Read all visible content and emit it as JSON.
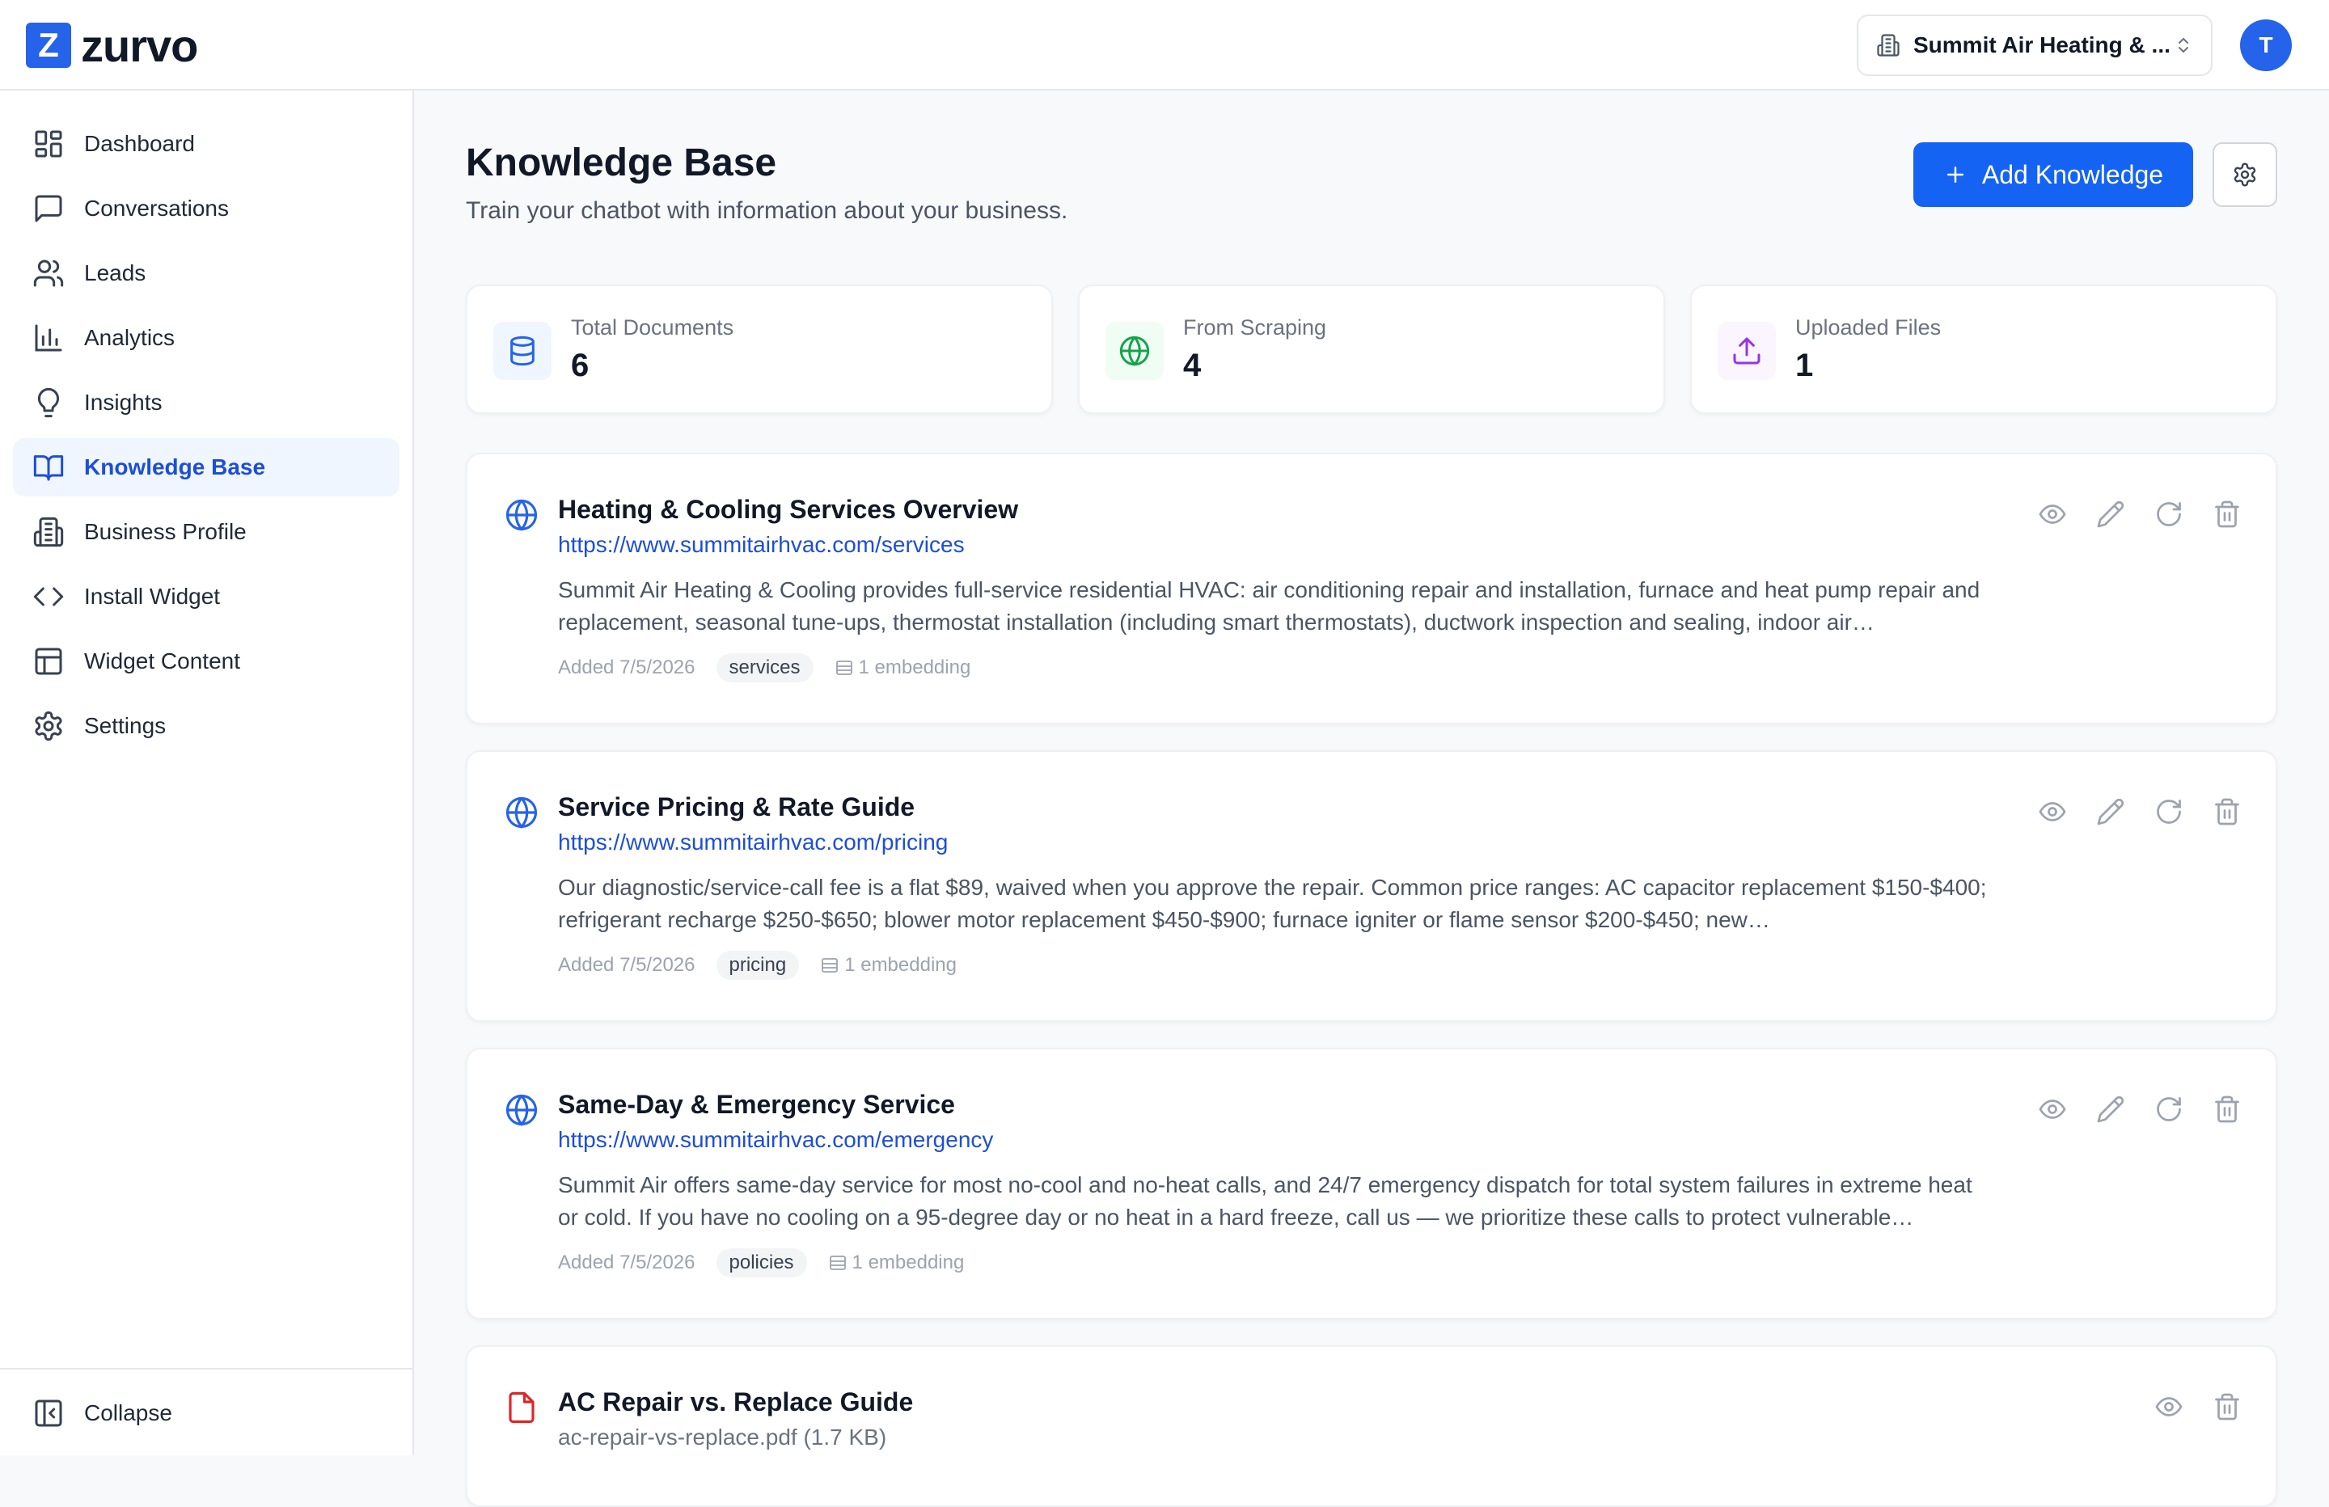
{
  "header": {
    "logo_letter": "Z",
    "logo_text": "zurvo",
    "business_name": "Summit Air Heating & ...",
    "avatar_initial": "T"
  },
  "sidebar": {
    "items": [
      {
        "label": "Dashboard",
        "icon": "dashboard-icon"
      },
      {
        "label": "Conversations",
        "icon": "chat-icon"
      },
      {
        "label": "Leads",
        "icon": "users-icon"
      },
      {
        "label": "Analytics",
        "icon": "bar-chart-icon"
      },
      {
        "label": "Insights",
        "icon": "lightbulb-icon"
      },
      {
        "label": "Knowledge Base",
        "icon": "book-icon",
        "active": true
      },
      {
        "label": "Business Profile",
        "icon": "building-icon"
      },
      {
        "label": "Install Widget",
        "icon": "code-icon"
      },
      {
        "label": "Widget Content",
        "icon": "layout-icon"
      },
      {
        "label": "Settings",
        "icon": "gear-icon"
      }
    ],
    "collapse_label": "Collapse"
  },
  "page": {
    "title": "Knowledge Base",
    "subtitle": "Train your chatbot with information about your business.",
    "add_button": "Add Knowledge"
  },
  "stats": [
    {
      "label": "Total Documents",
      "value": "6",
      "icon": "database-icon",
      "color": "#2563eb"
    },
    {
      "label": "From Scraping",
      "value": "4",
      "icon": "globe-icon",
      "color": "#16a34a"
    },
    {
      "label": "Uploaded Files",
      "value": "1",
      "icon": "upload-icon",
      "color": "#9333ea"
    }
  ],
  "documents": [
    {
      "title": "Heating & Cooling Services Overview",
      "url": "https://www.summitairhvac.com/services",
      "text": "Summit Air Heating & Cooling provides full-service residential HVAC: air conditioning repair and installation, furnace and heat pump repair and replacement, seasonal tune-ups, thermostat installation (including smart thermostats), ductwork inspection and sealing, indoor air…",
      "added": "Added 7/5/2026",
      "tag": "services",
      "embeddings": "1 embedding"
    },
    {
      "title": "Service Pricing & Rate Guide",
      "url": "https://www.summitairhvac.com/pricing",
      "text": "Our diagnostic/service-call fee is a flat $89, waived when you approve the repair. Common price ranges: AC capacitor replacement $150-$400; refrigerant recharge $250-$650; blower motor replacement $450-$900; furnace igniter or flame sensor $200-$450; new…",
      "added": "Added 7/5/2026",
      "tag": "pricing",
      "embeddings": "1 embedding"
    },
    {
      "title": "Same-Day & Emergency Service",
      "url": "https://www.summitairhvac.com/emergency",
      "text": "Summit Air offers same-day service for most no-cool and no-heat calls, and 24/7 emergency dispatch for total system failures in extreme heat or cold. If you have no cooling on a 95-degree day or no heat in a hard freeze, call us — we prioritize these calls to protect vulnerable…",
      "added": "Added 7/5/2026",
      "tag": "policies",
      "embeddings": "1 embedding"
    },
    {
      "title": "AC Repair vs. Replace Guide",
      "file": "ac-repair-vs-replace.pdf (1.7 KB)"
    }
  ]
}
